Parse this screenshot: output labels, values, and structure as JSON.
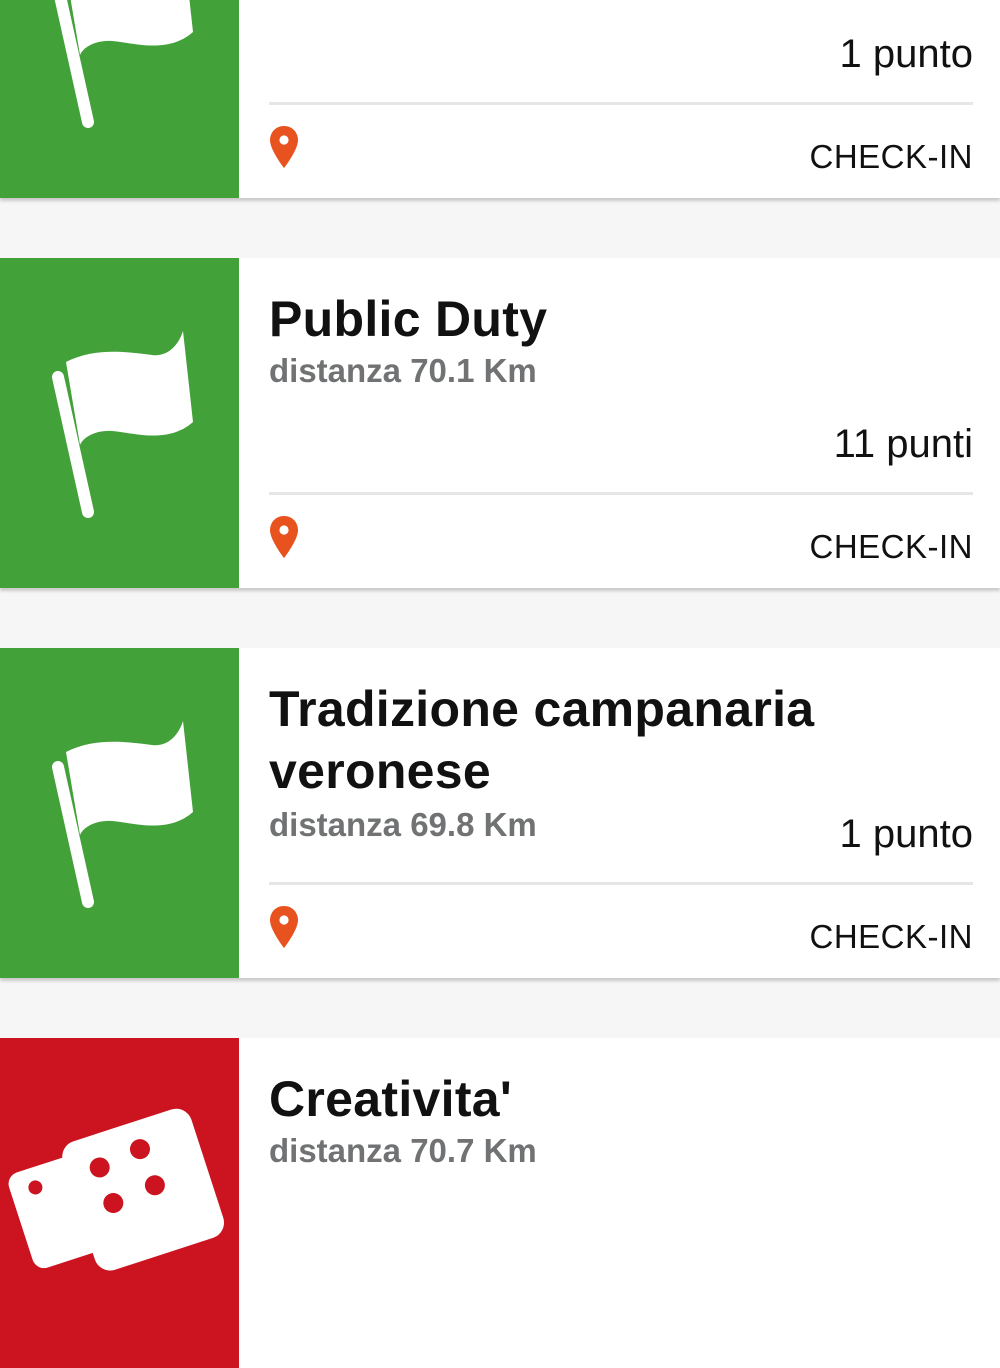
{
  "colors": {
    "green": "#43a13a",
    "red": "#cc1420",
    "pin": "#e8521f"
  },
  "cards": [
    {
      "icon": "flag-icon",
      "title": "",
      "distance": "",
      "points": "1 punto",
      "action": "CHECK-IN"
    },
    {
      "icon": "flag-icon",
      "title": "Public Duty",
      "distance": "distanza 70.1 Km",
      "points": "11 punti",
      "action": "CHECK-IN"
    },
    {
      "icon": "flag-icon",
      "title": "Tradizione campanaria veronese",
      "distance": "distanza 69.8 Km",
      "points": "1 punto",
      "action": "CHECK-IN"
    },
    {
      "icon": "dice-icon",
      "title": "Creativita'",
      "distance": "distanza 70.7 Km"
    }
  ]
}
